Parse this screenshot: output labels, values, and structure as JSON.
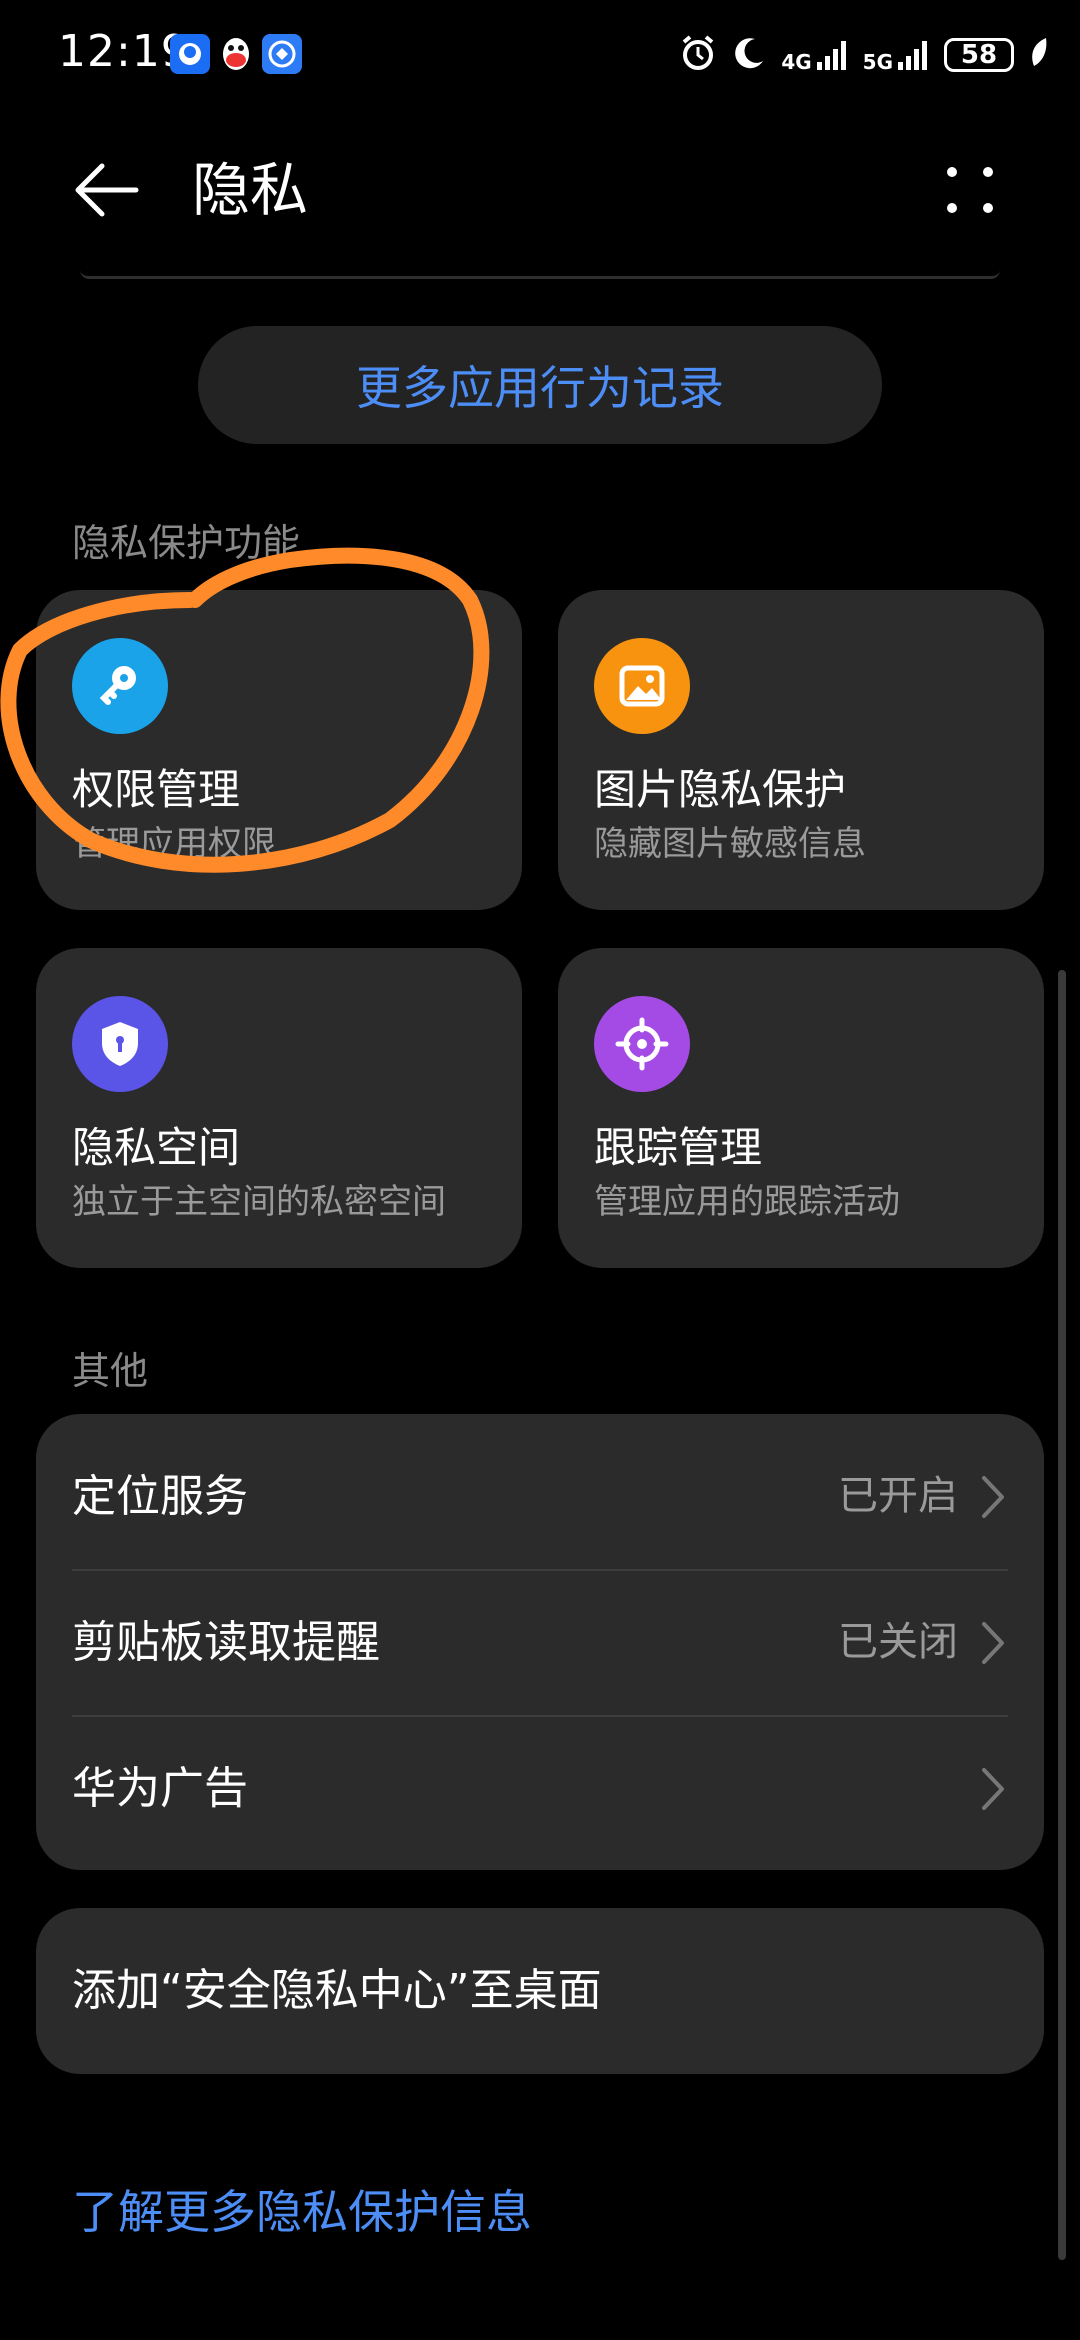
{
  "status_bar": {
    "time": "12:19",
    "net_left": "4G",
    "net_right": "5G",
    "battery": "58"
  },
  "header": {
    "title": "隐私"
  },
  "more_records_button": "更多应用行为记录",
  "section_privacy": {
    "label": "隐私保护功能",
    "cards": [
      {
        "title": "权限管理",
        "subtitle": "管理应用权限",
        "icon": "key-icon",
        "color": "#1aa3e8"
      },
      {
        "title": "图片隐私保护",
        "subtitle": "隐藏图片敏感信息",
        "icon": "image-icon",
        "color": "#f7930f"
      },
      {
        "title": "隐私空间",
        "subtitle": "独立于主空间的私密空间",
        "icon": "shield-icon",
        "color": "#5a55e6"
      },
      {
        "title": "跟踪管理",
        "subtitle": "管理应用的跟踪活动",
        "icon": "target-icon",
        "color": "#a44be6"
      }
    ]
  },
  "section_other": {
    "label": "其他",
    "rows": [
      {
        "label": "定位服务",
        "value": "已开启"
      },
      {
        "label": "剪贴板读取提醒",
        "value": "已关闭"
      },
      {
        "label": "华为广告",
        "value": ""
      }
    ]
  },
  "add_to_desktop": "添加“安全隐私中心”至桌面",
  "learn_more_link": "了解更多隐私保护信息",
  "colors": {
    "accent_link": "#4c8df6",
    "card_bg": "#2b2b2b",
    "annotation": "#ff8a2a"
  }
}
